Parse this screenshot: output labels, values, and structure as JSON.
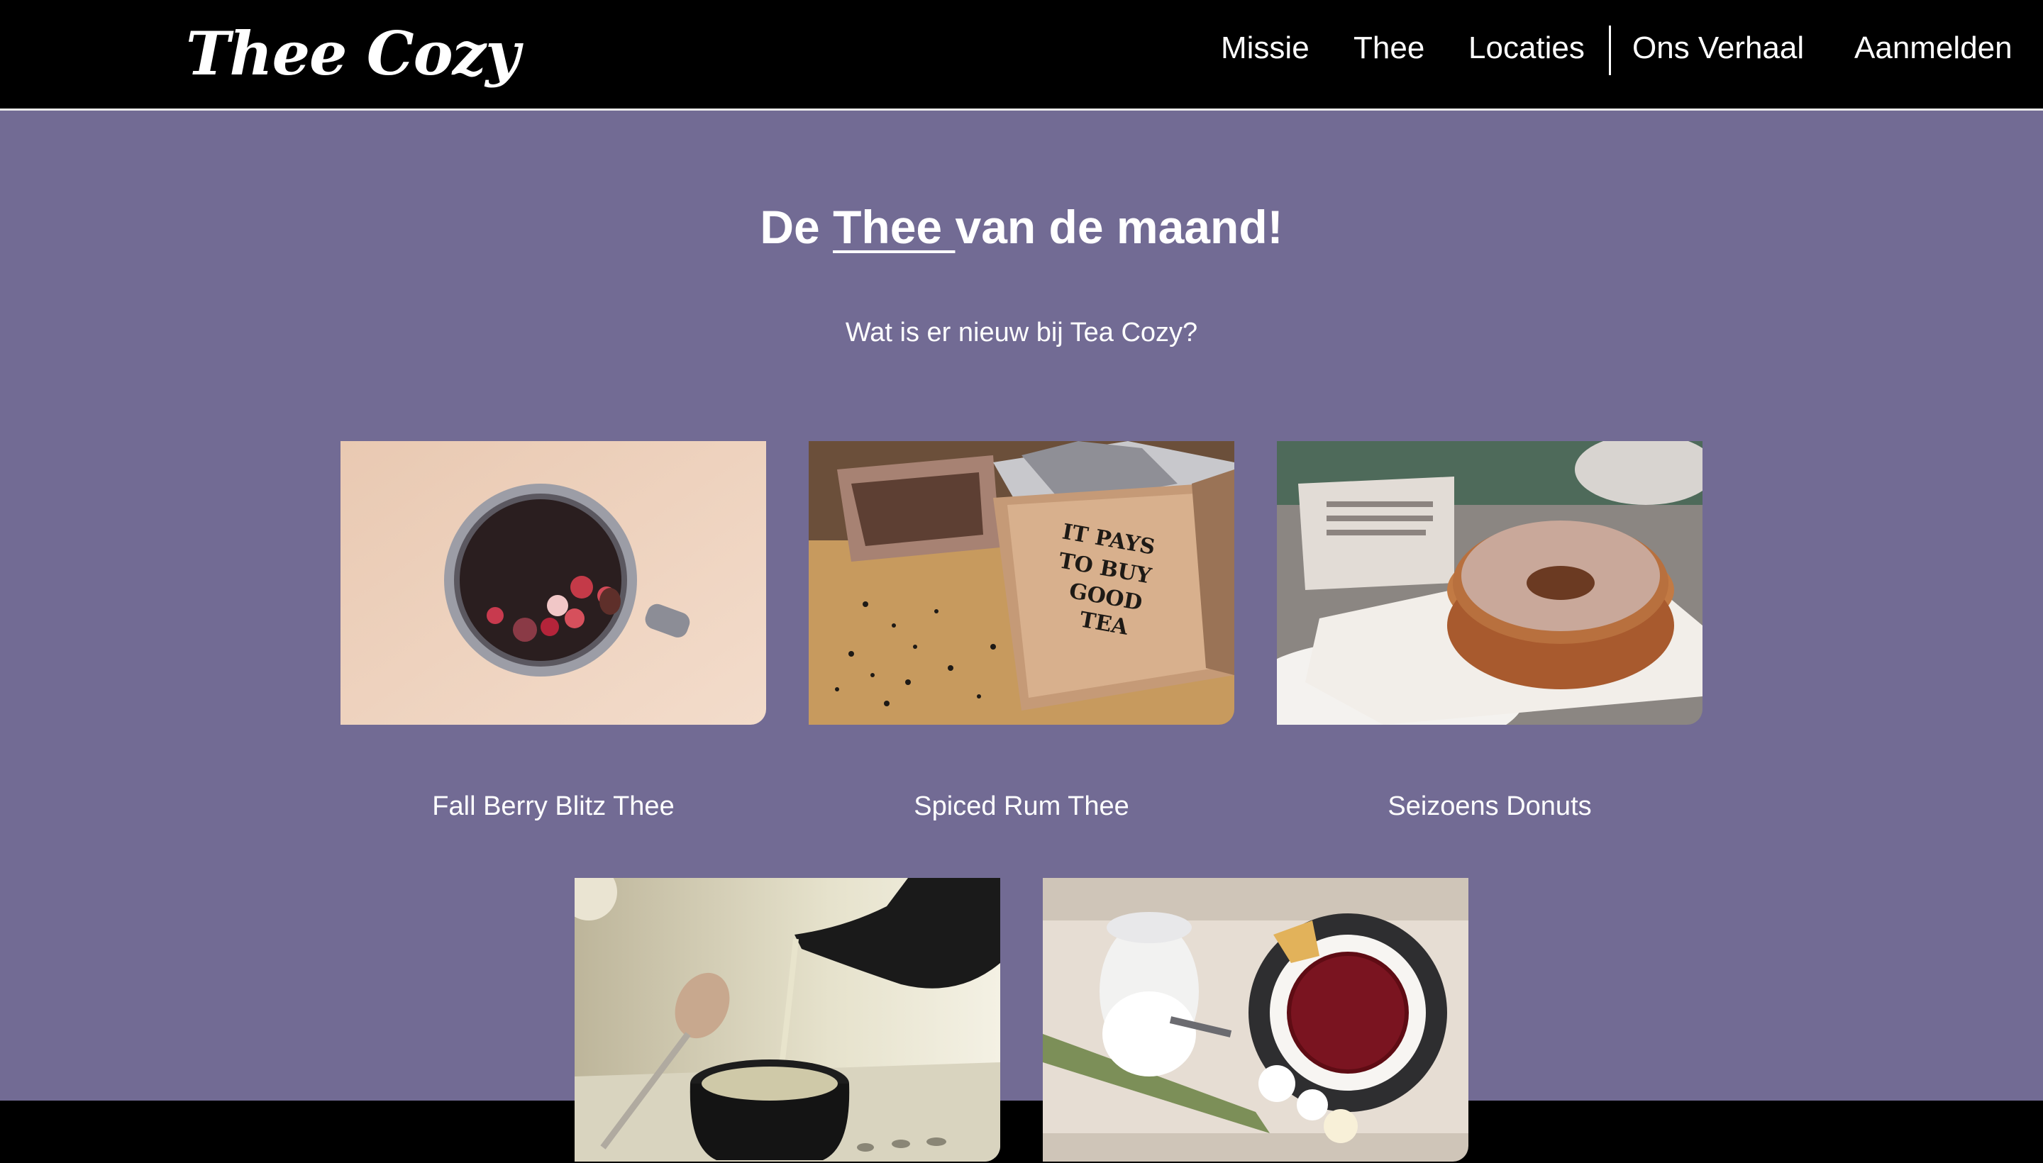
{
  "brand": {
    "logo_text": "Thee Cozy"
  },
  "nav": {
    "items": [
      {
        "label": "Missie"
      },
      {
        "label": "Thee"
      },
      {
        "label": "Locaties"
      },
      {
        "label": "Ons Verhaal"
      },
      {
        "label": "Aanmelden"
      }
    ]
  },
  "hero": {
    "title_prefix": "De ",
    "title_link": "Thee ",
    "title_suffix": "van de maand!",
    "subtitle": "Wat is er nieuw bij Tea Cozy?"
  },
  "products": [
    {
      "caption": "Fall Berry Blitz Thee",
      "image": "berry-tea-mug-photo"
    },
    {
      "caption": "Spiced Rum Thee",
      "image": "tea-box-photo"
    },
    {
      "caption": "Seizoens Donuts",
      "image": "donut-photo"
    },
    {
      "caption": "",
      "image": "teapot-pouring-photo"
    },
    {
      "caption": "",
      "image": "tea-cup-sugar-jar-photo"
    }
  ],
  "tea_box_text": [
    "IT PAYS",
    "TO BUY",
    "GOOD",
    "TEA"
  ],
  "colors": {
    "background": "#726b94",
    "header": "#000000",
    "text": "#ffffff"
  }
}
